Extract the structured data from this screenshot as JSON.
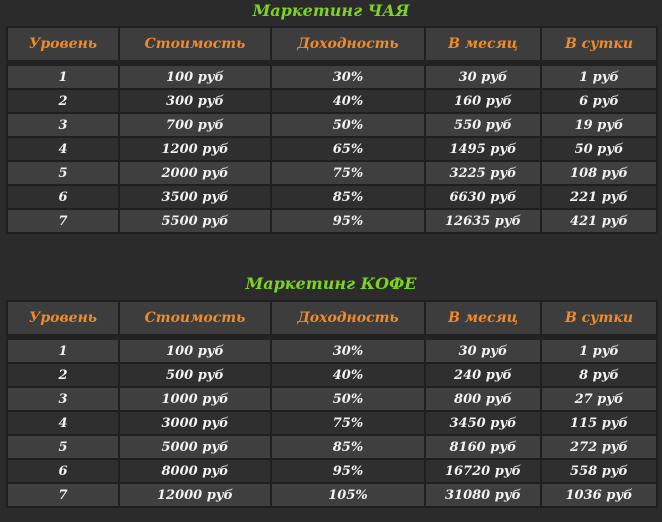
{
  "sections": [
    {
      "title": "Маркетинг ЧАЯ",
      "headers": [
        "Уровень",
        "Стоимость",
        "Доходность",
        "В месяц",
        "В сутки"
      ],
      "rows": [
        [
          "1",
          "100 руб",
          "30%",
          "30 руб",
          "1 руб"
        ],
        [
          "2",
          "300 руб",
          "40%",
          "160 руб",
          "6 руб"
        ],
        [
          "3",
          "700 руб",
          "50%",
          "550 руб",
          "19 руб"
        ],
        [
          "4",
          "1200 руб",
          "65%",
          "1495 руб",
          "50 руб"
        ],
        [
          "5",
          "2000 руб",
          "75%",
          "3225 руб",
          "108 руб"
        ],
        [
          "6",
          "3500 руб",
          "85%",
          "6630 руб",
          "221 руб"
        ],
        [
          "7",
          "5500 руб",
          "95%",
          "12635 руб",
          "421 руб"
        ]
      ]
    },
    {
      "title": "Маркетинг КОФЕ",
      "headers": [
        "Уровень",
        "Стоимость",
        "Доходность",
        "В месяц",
        "В сутки"
      ],
      "rows": [
        [
          "1",
          "100 руб",
          "30%",
          "30 руб",
          "1 руб"
        ],
        [
          "2",
          "500 руб",
          "40%",
          "240 руб",
          "8 руб"
        ],
        [
          "3",
          "1000 руб",
          "50%",
          "800 руб",
          "27 руб"
        ],
        [
          "4",
          "3000 руб",
          "75%",
          "3450 руб",
          "115 руб"
        ],
        [
          "5",
          "5000 руб",
          "85%",
          "8160 руб",
          "272 руб"
        ],
        [
          "6",
          "8000 руб",
          "95%",
          "16720 руб",
          "558 руб"
        ],
        [
          "7",
          "12000 руб",
          "105%",
          "31080 руб",
          "1036 руб"
        ]
      ]
    }
  ],
  "colors": {
    "background": "#2b2b2b",
    "title": "#7ed321",
    "header_text": "#f08a2a",
    "cell_text": "#f2f2f2",
    "row_odd": "#3f3f3f",
    "row_even": "#2f2f2f"
  }
}
